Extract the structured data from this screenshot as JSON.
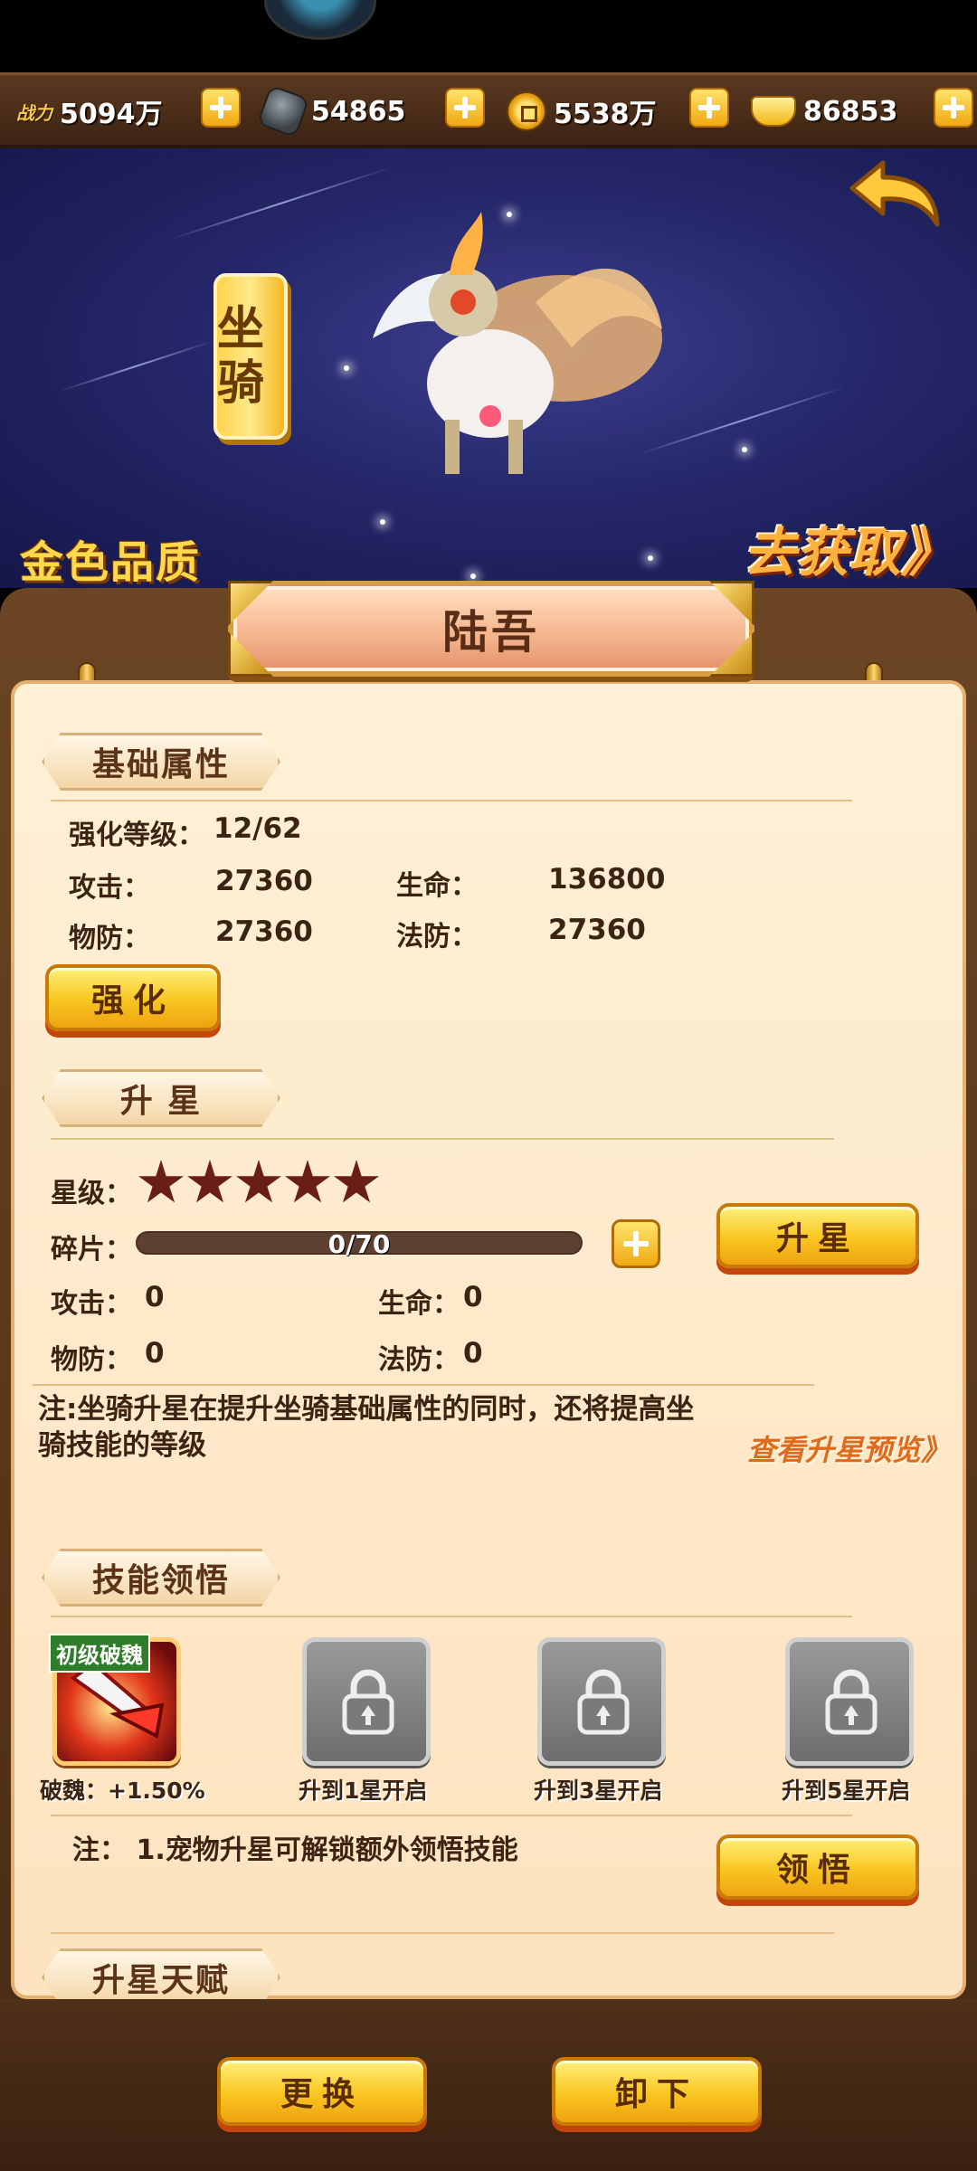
{
  "resources": [
    {
      "label": "战力",
      "value": "5094万",
      "icon": "power-icon"
    },
    {
      "label": "",
      "value": "54865",
      "icon": "ore-icon"
    },
    {
      "label": "",
      "value": "5538万",
      "icon": "coin-icon"
    },
    {
      "label": "",
      "value": "86853",
      "icon": "ingot-icon"
    }
  ],
  "scene": {
    "category": "坐骑",
    "quality": "金色品质",
    "obtain_link": "去获取》"
  },
  "mount": {
    "name": "陆吾"
  },
  "basic": {
    "title": "基础属性",
    "level_label": "强化等级：",
    "level_value": "12/62",
    "attack_label": "攻击：",
    "attack_value": "27360",
    "hp_label": "生命：",
    "hp_value": "136800",
    "pdef_label": "物防：",
    "pdef_value": "27360",
    "mdef_label": "法防：",
    "mdef_value": "27360",
    "enhance_button": "强化"
  },
  "star": {
    "title": "升 星",
    "star_label": "星级：",
    "stars_lit": 0,
    "stars_total": 5,
    "shard_label": "碎片：",
    "shard_text": "0/70",
    "shard_progress": 0,
    "upgrade_button": "升星",
    "attack_label": "攻击：",
    "attack_value": "0",
    "hp_label": "生命：",
    "hp_value": "0",
    "pdef_label": "物防：",
    "pdef_value": "0",
    "mdef_label": "法防：",
    "mdef_value": "0",
    "note": "注:坐骑升星在提升坐骑基础属性的同时，还将提高坐骑技能的等级",
    "preview_link": "查看升星预览》"
  },
  "skills": {
    "title": "技能领悟",
    "slots": [
      {
        "tag": "初级破魏",
        "caption": "破魏：+1.50%",
        "locked": false,
        "icon": "skill-blade-icon"
      },
      {
        "caption": "升到1星开启",
        "locked": true,
        "icon": "lock-icon"
      },
      {
        "caption": "升到3星开启",
        "locked": true,
        "icon": "lock-icon"
      },
      {
        "caption": "升到5星开启",
        "locked": true,
        "icon": "lock-icon"
      }
    ],
    "note": "注： 1.宠物升星可解锁额外领悟技能",
    "comprehend_button": "领悟"
  },
  "talent": {
    "title": "升星天赋"
  },
  "footer": {
    "change_button": "更换",
    "unequip_button": "卸下"
  },
  "colors": {
    "gold_button": "#f8c520",
    "star_dim": "#6a1f14",
    "paper": "#fde3bf",
    "wood": "#4a2d15",
    "quality_gold": "#ffd94a"
  }
}
